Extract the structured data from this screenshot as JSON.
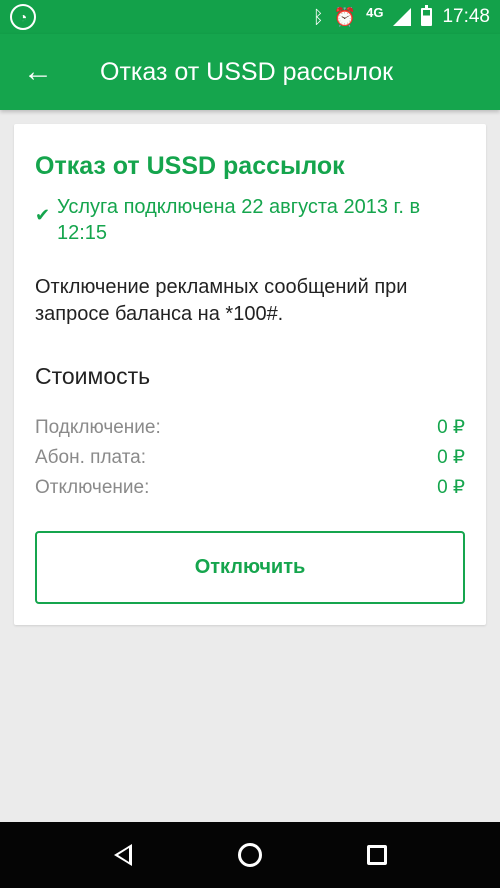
{
  "status_bar": {
    "app_icon": "megafon-app-icon",
    "network": "4G",
    "time": "17:48"
  },
  "app_bar": {
    "title": "Отказ от USSD рассылок"
  },
  "service": {
    "title": "Отказ от USSD рассылок",
    "status": "Услуга подключена 22 августа 2013 г. в 12:15",
    "description": "Отключение рекламных сообщений при запросе баланса на *100#."
  },
  "cost": {
    "heading": "Стоимость",
    "rows": [
      {
        "label": "Подключение:",
        "value": "0 ₽"
      },
      {
        "label": "Абон. плата:",
        "value": "0 ₽"
      },
      {
        "label": "Отключение:",
        "value": "0 ₽"
      }
    ]
  },
  "actions": {
    "disconnect_label": "Отключить"
  },
  "colors": {
    "accent": "#15a54d",
    "status_bar": "#13a14a",
    "background": "#ebebeb"
  }
}
